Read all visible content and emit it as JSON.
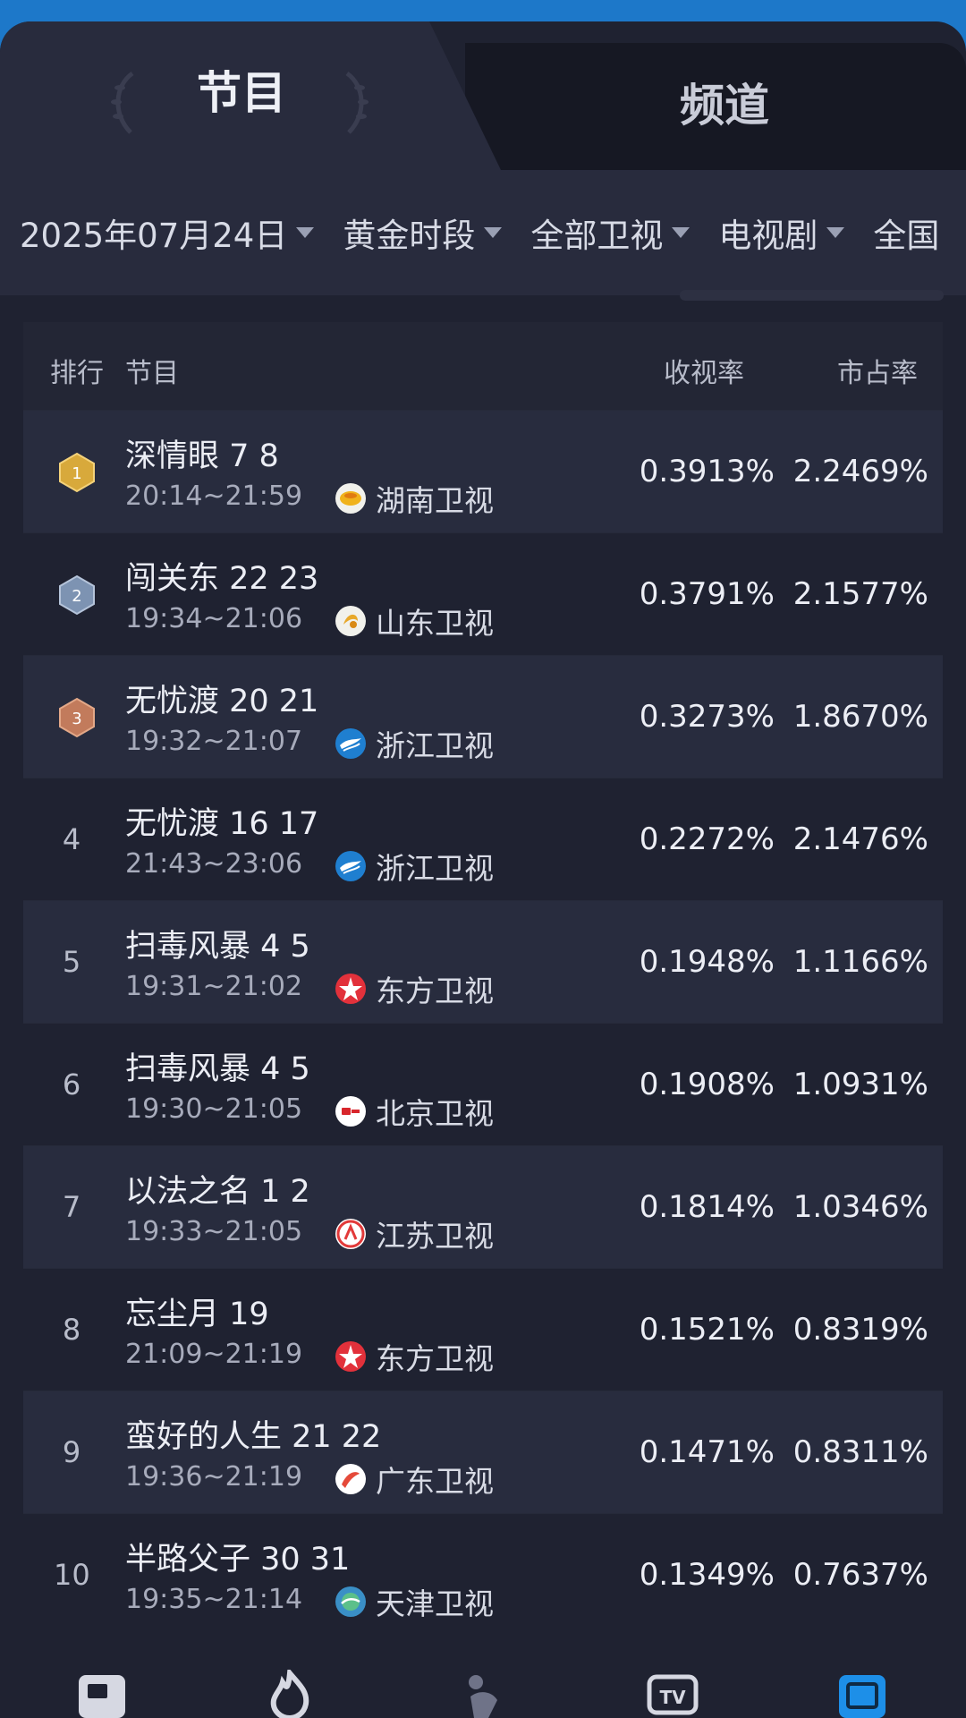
{
  "tabs": {
    "programs": "节目",
    "channels": "频道"
  },
  "filters": [
    {
      "label": "2025年07月24日"
    },
    {
      "label": "黄金时段"
    },
    {
      "label": "全部卫视"
    },
    {
      "label": "电视剧"
    },
    {
      "label": "全国"
    }
  ],
  "table": {
    "headers": {
      "rank": "排行",
      "program": "节目",
      "rating": "收视率",
      "share": "市占率"
    },
    "rows": [
      {
        "rank": "1",
        "title": "深情眼 7 8",
        "time": "20:14~21:59",
        "channel": "湖南卫视",
        "rating": "0.3913%",
        "share": "2.2469%"
      },
      {
        "rank": "2",
        "title": "闯关东 22 23",
        "time": "19:34~21:06",
        "channel": "山东卫视",
        "rating": "0.3791%",
        "share": "2.1577%"
      },
      {
        "rank": "3",
        "title": "无忧渡 20 21",
        "time": "19:32~21:07",
        "channel": "浙江卫视",
        "rating": "0.3273%",
        "share": "1.8670%"
      },
      {
        "rank": "4",
        "title": "无忧渡 16 17",
        "time": "21:43~23:06",
        "channel": "浙江卫视",
        "rating": "0.2272%",
        "share": "2.1476%"
      },
      {
        "rank": "5",
        "title": "扫毒风暴 4 5",
        "time": "19:31~21:02",
        "channel": "东方卫视",
        "rating": "0.1948%",
        "share": "1.1166%"
      },
      {
        "rank": "6",
        "title": "扫毒风暴 4 5",
        "time": "19:30~21:05",
        "channel": "北京卫视",
        "rating": "0.1908%",
        "share": "1.0931%"
      },
      {
        "rank": "7",
        "title": "以法之名 1 2",
        "time": "19:33~21:05",
        "channel": "江苏卫视",
        "rating": "0.1814%",
        "share": "1.0346%"
      },
      {
        "rank": "8",
        "title": "忘尘月 19",
        "time": "21:09~21:19",
        "channel": "东方卫视",
        "rating": "0.1521%",
        "share": "0.8319%"
      },
      {
        "rank": "9",
        "title": "蛮好的人生 21 22",
        "time": "19:36~21:19",
        "channel": "广东卫视",
        "rating": "0.1471%",
        "share": "0.8311%"
      },
      {
        "rank": "10",
        "title": "半路父子 30 31",
        "time": "19:35~21:14",
        "channel": "天津卫视",
        "rating": "0.1349%",
        "share": "0.7637%"
      }
    ]
  },
  "colors": {
    "medal_gold": "#d8a93b",
    "medal_silver": "#7d93b2",
    "medal_bronze": "#c27b5c",
    "hunan": "#f0b21b",
    "shandong": "#e8a82a",
    "zhejiang": "#1f7fd0",
    "dongfang": "#e2313b",
    "beijing": "#ffffff",
    "jiangsu": "#e23a3a",
    "guangdong": "#e54a3a",
    "tianjin": "#3a8fc6"
  }
}
